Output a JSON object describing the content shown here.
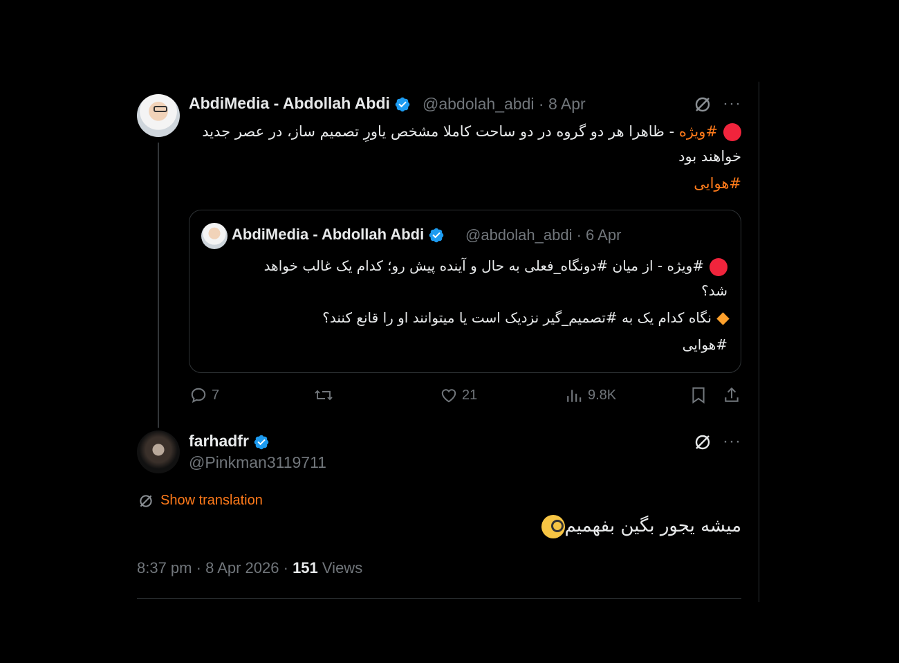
{
  "tweet": {
    "author_name": "AbdiMedia - Abdollah Abdi",
    "handle": "@abdolah_abdi",
    "date": "8 Apr",
    "hashtag_lead": "#ویژه",
    "text_line1": " - ظاهرا هر دو گروه در دو ساحت کاملا مشخص یاورِ تصمیم ساز، در عصر جدید",
    "text_line2": "خواهند بود",
    "hashtag_tail": "#هوایی"
  },
  "quote": {
    "author_name": "AbdiMedia - Abdollah Abdi",
    "handle": "@abdolah_abdi",
    "date": "6 Apr",
    "line1": "#ویژه - از میان #دونگاه_فعلی به حال و آینده پیش رو؛ کدام یک غالب خواهد",
    "line2": "شد؟",
    "line3": "نگاه کدام یک به #تصمیم_گیر نزدیک است یا میتوانند او را قانع کنند؟",
    "line4": "#هوایی"
  },
  "actions": {
    "replies": "7",
    "likes": "21",
    "views": "9.8K"
  },
  "reply": {
    "author_name": "farhadfr",
    "handle": "@Pinkman3119711",
    "show_translation": "Show translation",
    "text": "میشه یجور بگین بفهمیم",
    "time": "8:37 pm",
    "date": "8 Apr 2026",
    "views_count": "151",
    "views_label": "Views"
  },
  "icons": {
    "verified": "verified-badge-icon",
    "grok": "grok-icon",
    "more": "more-icon",
    "reply": "reply-icon",
    "retweet": "retweet-icon",
    "like": "like-icon",
    "views": "views-icon",
    "bookmark": "bookmark-icon",
    "share": "share-icon",
    "translate": "translate-icon"
  },
  "colors": {
    "background": "#000000",
    "accent": "#ff7a1a",
    "verified": "#1d9bf0",
    "muted": "#71767b",
    "text": "#e7e9ea"
  }
}
